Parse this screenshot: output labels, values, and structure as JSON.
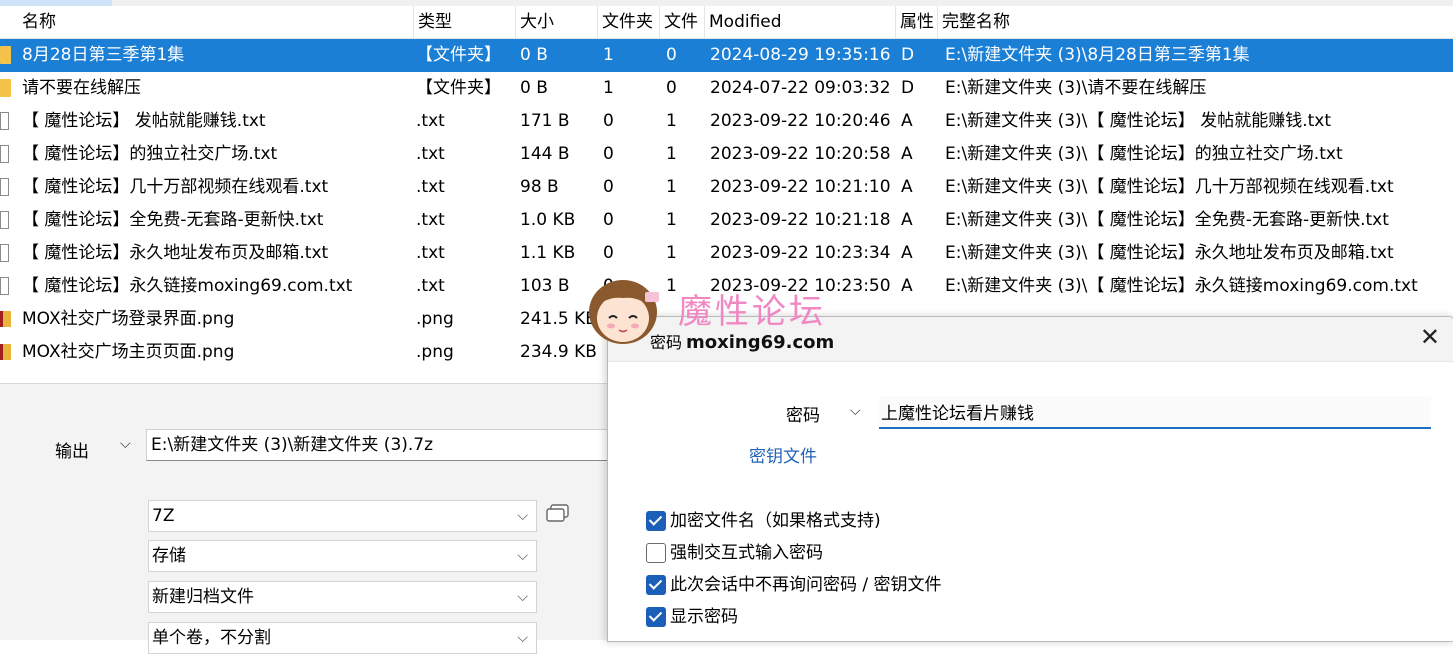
{
  "columns": {
    "name": "名称",
    "type": "类型",
    "size": "大小",
    "folders": "文件夹",
    "files": "文件",
    "modified": "Modified",
    "attr": "属性",
    "fullname": "完整名称"
  },
  "rows": [
    {
      "name": "8月28日第三季第1集",
      "type": "【文件夹】",
      "size": "0 B",
      "folders": "1",
      "files": "0",
      "modified": "2024-08-29 19:35:16",
      "attr": "D",
      "full": "E:\\新建文件夹 (3)\\8月28日第三季第1集",
      "icon": "folder-icon"
    },
    {
      "name": "请不要在线解压",
      "type": "【文件夹】",
      "size": "0 B",
      "folders": "1",
      "files": "0",
      "modified": "2024-07-22 09:03:32",
      "attr": "D",
      "full": "E:\\新建文件夹 (3)\\请不要在线解压",
      "icon": "folder-icon"
    },
    {
      "name": "【 魔性论坛】 发帖就能赚钱.txt",
      "type": ".txt",
      "size": "171 B",
      "folders": "0",
      "files": "1",
      "modified": "2023-09-22 10:20:46",
      "attr": "A",
      "full": "E:\\新建文件夹 (3)\\【 魔性论坛】 发帖就能赚钱.txt",
      "icon": "text-file-icon"
    },
    {
      "name": "【 魔性论坛】的独立社交广场.txt",
      "type": ".txt",
      "size": "144 B",
      "folders": "0",
      "files": "1",
      "modified": "2023-09-22 10:20:58",
      "attr": "A",
      "full": "E:\\新建文件夹 (3)\\【 魔性论坛】的独立社交广场.txt",
      "icon": "text-file-icon"
    },
    {
      "name": "【 魔性论坛】几十万部视频在线观看.txt",
      "type": ".txt",
      "size": "98 B",
      "folders": "0",
      "files": "1",
      "modified": "2023-09-22 10:21:10",
      "attr": "A",
      "full": "E:\\新建文件夹 (3)\\【 魔性论坛】几十万部视频在线观看.txt",
      "icon": "text-file-icon"
    },
    {
      "name": "【 魔性论坛】全免费-无套路-更新快.txt",
      "type": ".txt",
      "size": "1.0 KB",
      "folders": "0",
      "files": "1",
      "modified": "2023-09-22 10:21:18",
      "attr": "A",
      "full": "E:\\新建文件夹 (3)\\【 魔性论坛】全免费-无套路-更新快.txt",
      "icon": "text-file-icon"
    },
    {
      "name": "【 魔性论坛】永久地址发布页及邮箱.txt",
      "type": ".txt",
      "size": "1.1 KB",
      "folders": "0",
      "files": "1",
      "modified": "2023-09-22 10:23:34",
      "attr": "A",
      "full": "E:\\新建文件夹 (3)\\【 魔性论坛】永久地址发布页及邮箱.txt",
      "icon": "text-file-icon"
    },
    {
      "name": "【 魔性论坛】永久链接moxing69.com.txt",
      "type": ".txt",
      "size": "103 B",
      "folders": "0",
      "files": "1",
      "modified": "2023-09-22 10:23:50",
      "attr": "A",
      "full": "E:\\新建文件夹 (3)\\【 魔性论坛】永久链接moxing69.com.txt",
      "icon": "text-file-icon"
    },
    {
      "name": "MOX社交广场登录界面.png",
      "type": ".png",
      "size": "241.5 KB",
      "folders": "",
      "files": "",
      "modified": "",
      "attr": "",
      "full": "",
      "icon": "image-file-icon"
    },
    {
      "name": "MOX社交广场主页页面.png",
      "type": ".png",
      "size": "234.9 KB",
      "folders": "",
      "files": "",
      "modified": "",
      "attr": "",
      "full": "",
      "icon": "image-file-icon"
    }
  ],
  "archive": {
    "output_label": "输出",
    "output_path": "E:\\新建文件夹 (3)\\新建文件夹 (3).7z",
    "format": "7Z",
    "compression": "存储",
    "update_mode": "新建归档文件",
    "volume": "单个卷，不分割"
  },
  "watermark": {
    "title": "魔性论坛",
    "url": "moxing69.com"
  },
  "dialog": {
    "title": "密码",
    "password_label": "密码",
    "password_value": "上魔性论坛看片赚钱",
    "key_file_link": "密钥文件",
    "options": [
      {
        "label": "加密文件名（如果格式支持)",
        "checked": true
      },
      {
        "label": "强制交互式输入密码",
        "checked": false
      },
      {
        "label": "此次会话中不再询问密码 / 密钥文件",
        "checked": true
      },
      {
        "label": "显示密码",
        "checked": true
      }
    ]
  },
  "colors": {
    "selection": "#1b7fd6",
    "accent": "#1c5fb8",
    "link": "#1f63b7",
    "watermark": "#f088c4"
  }
}
